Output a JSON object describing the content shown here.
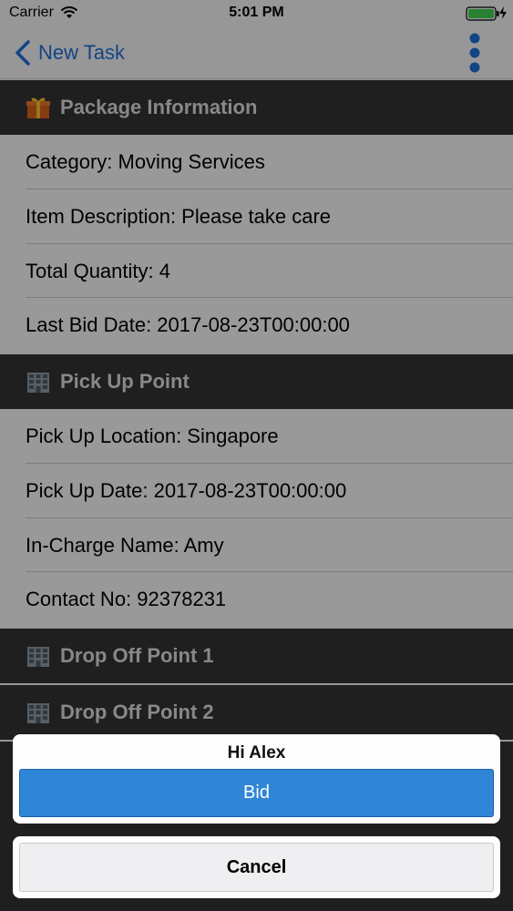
{
  "status_bar": {
    "carrier": "Carrier",
    "time": "5:01 PM"
  },
  "nav": {
    "back_label": "New Task",
    "more_icon": "more-vertical-icon",
    "accent": "#1f6fd6"
  },
  "sections": {
    "package": {
      "title": "Package Information",
      "icon": "gift-icon",
      "rows": [
        "Category: Moving Services",
        "Item Description: Please take care",
        "Total Quantity: 4",
        "Last Bid Date: 2017-08-23T00:00:00"
      ]
    },
    "pickup": {
      "title": "Pick Up Point",
      "icon": "building-icon",
      "rows": [
        "Pick Up Location: Singapore",
        "Pick Up Date: 2017-08-23T00:00:00",
        "In-Charge Name: Amy",
        "Contact No: 92378231"
      ]
    },
    "dropoff1": {
      "title": "Drop Off Point 1",
      "icon": "building-icon"
    },
    "dropoff2": {
      "title": "Drop Off Point 2",
      "icon": "building-icon"
    }
  },
  "action_sheet": {
    "title": "Hi Alex",
    "bid_label": "Bid",
    "cancel_label": "Cancel",
    "bid_color": "#2f86d6"
  }
}
